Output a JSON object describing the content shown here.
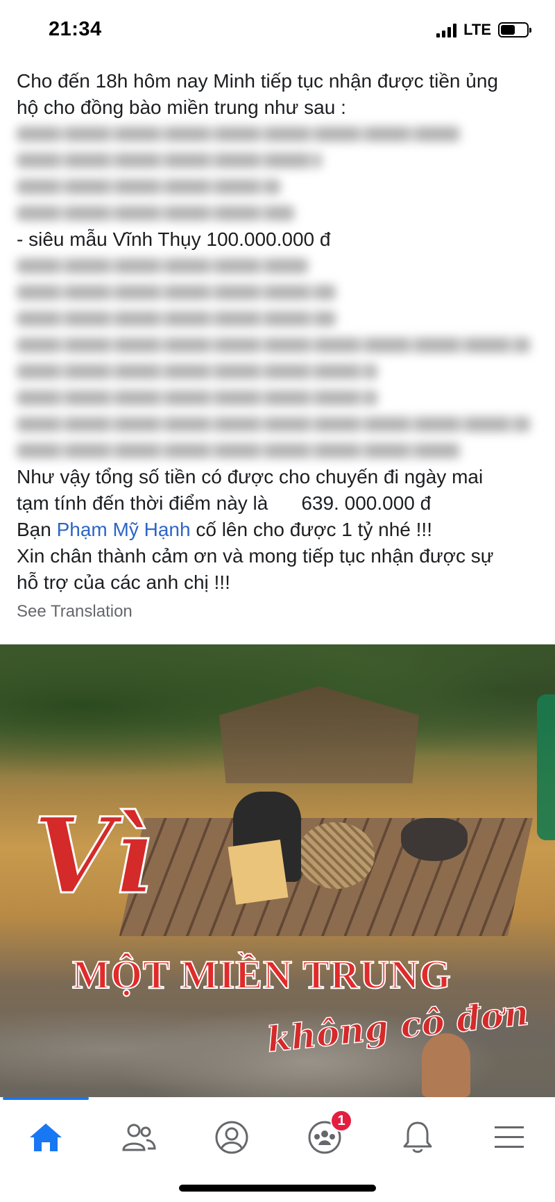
{
  "status_bar": {
    "time": "21:34",
    "network": "LTE",
    "battery_level": 0.55
  },
  "post": {
    "lines": [
      {
        "text": "Cho đến 18h  hôm nay Minh tiếp tục nhận được tiền ủng",
        "blurred": false
      },
      {
        "text": "hộ cho đồng bào miền trung như sau :",
        "blurred": false
      },
      {
        "text": "",
        "blurred": true
      },
      {
        "text": "",
        "blurred": true
      },
      {
        "text": "",
        "blurred": true
      },
      {
        "text": "",
        "blurred": true
      },
      {
        "text": "- siêu mẫu Vĩnh Thụy 100.000.000 đ",
        "blurred": false
      },
      {
        "text": "",
        "blurred": true
      },
      {
        "text": "",
        "blurred": true
      },
      {
        "text": "",
        "blurred": true
      },
      {
        "text": "",
        "blurred": true
      },
      {
        "text": "",
        "blurred": true
      },
      {
        "text": "",
        "blurred": true
      },
      {
        "text": "",
        "blurred": true
      },
      {
        "text": "",
        "blurred": true
      }
    ],
    "total_line_1": "Như vậy tổng số tiền có được cho chuyến đi ngày mai",
    "total_line_2_prefix": "tạm tính đến thời điểm này là",
    "total_amount": "639. 000.000  đ",
    "mention_prefix": "Bạn ",
    "mention_name": "Phạm Mỹ Hạnh",
    "mention_suffix": " cố lên cho được 1 tỷ nhé !!!",
    "thanks_line_1": "Xin chân thành cảm ơn và mong tiếp tục nhận được sự",
    "thanks_line_2": "hỗ trợ của các anh chị !!!",
    "see_translation": "See Translation"
  },
  "image": {
    "title_script": "Vì",
    "title_main": "MỘT MIỀN TRUNG",
    "title_sub": "không cô đơn"
  },
  "bottom_nav": {
    "items": [
      {
        "name": "home-icon",
        "active": true
      },
      {
        "name": "friends-icon",
        "active": false
      },
      {
        "name": "profile-icon",
        "active": false
      },
      {
        "name": "groups-icon",
        "active": false,
        "badge": "1"
      },
      {
        "name": "notifications-icon",
        "active": false
      },
      {
        "name": "menu-icon",
        "active": false
      }
    ]
  },
  "colors": {
    "accent": "#1877f2",
    "link": "#2d65c6",
    "badge": "#e41e3f",
    "text": "#1c1e21",
    "muted": "#65676b"
  }
}
